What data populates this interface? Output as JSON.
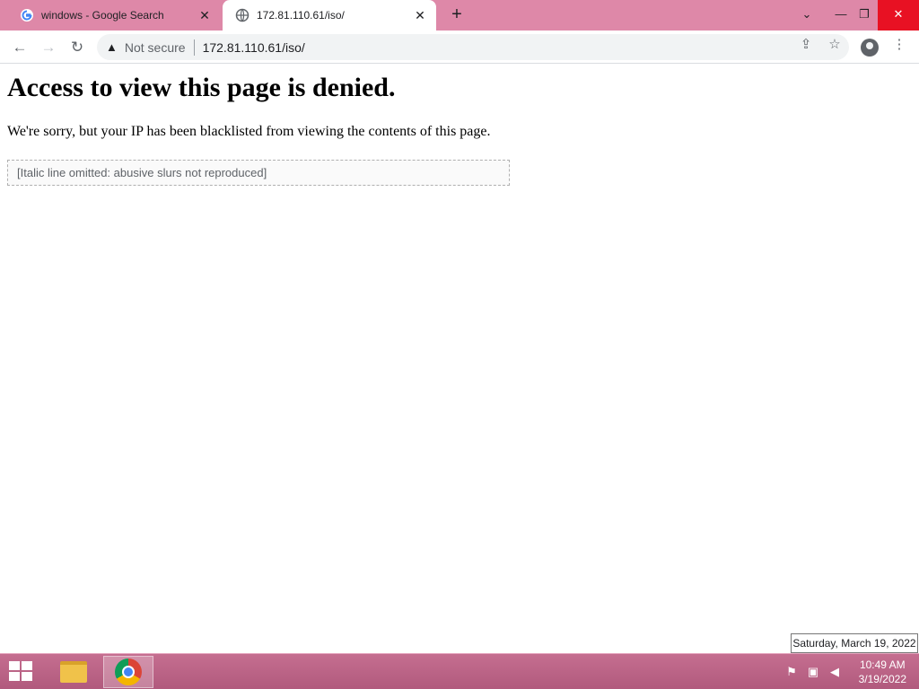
{
  "tabs": [
    {
      "title": "windows - Google Search",
      "favicon": "google-icon",
      "active": false
    },
    {
      "title": "172.81.110.61/iso/",
      "favicon": "globe-icon",
      "active": true
    }
  ],
  "toolbar": {
    "security_label": "Not secure",
    "url": "172.81.110.61/iso/"
  },
  "page": {
    "heading": "Access to view this page is denied.",
    "message": "We're sorry, but your IP has been blacklisted from viewing the contents of this page.",
    "omitted_note": "[Italic line omitted: abusive slurs not reproduced]"
  },
  "tooltip": "Saturday, March 19, 2022",
  "clock": {
    "time": "10:49 AM",
    "date": "3/19/2022"
  },
  "colors": {
    "tabstrip": "#de88a8",
    "taskbar": "#b15a7d"
  }
}
